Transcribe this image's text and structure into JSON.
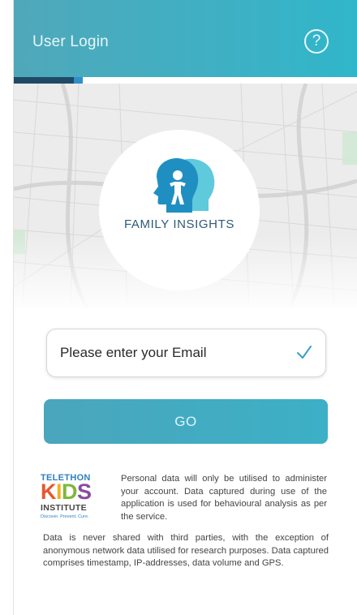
{
  "header": {
    "title": "User Login",
    "help_glyph": "?",
    "help_icon": "question-circle-icon"
  },
  "progress": {
    "value": 0.2
  },
  "brand": {
    "name": "FAMILY INSIGHTS",
    "logo_icon": "family-heads-icon",
    "colors": {
      "head_dark": "#1f8fc2",
      "head_light": "#5ecadb",
      "text": "#2e5a78"
    }
  },
  "login": {
    "email_placeholder": "Please enter your Email",
    "check_icon": "check-icon",
    "go_label": "GO"
  },
  "partner": {
    "line1": "TELETHON",
    "kids_letters": [
      "K",
      "I",
      "D",
      "S"
    ],
    "line3": "INSTITUTE",
    "tagline": "Discover. Prevent. Cure."
  },
  "privacy": {
    "p1": "Personal data will only be utilised to administer your account. Data captured during use of the application is used for behavioural analysis as per the service.",
    "p2": "Data is never shared with third parties, with the exception of anonymous network data utilised for research purposes. Data captured comprises timestamp, IP-addresses, data volume and GPS."
  },
  "colors": {
    "accent": "#3fb0c4",
    "accent_dark": "#1f4a66",
    "progress_tip": "#2f8fc9"
  }
}
